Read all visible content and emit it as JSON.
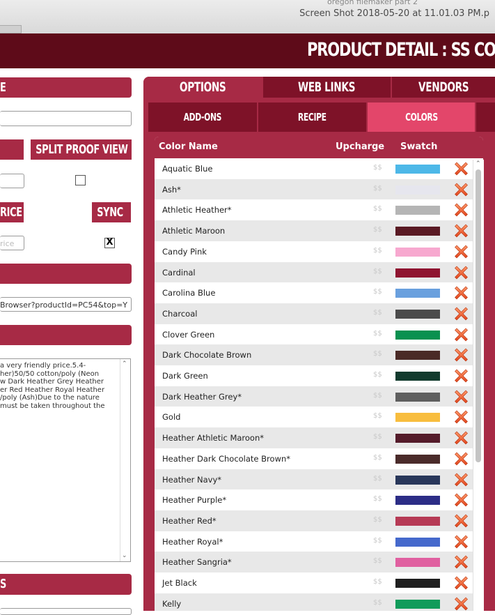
{
  "window": {
    "title": "Screen Shot 2018-05-20 at 11.01.03 PM.p",
    "faint_title": "oregon filemaker part 2"
  },
  "header": {
    "title": "PRODUCT DETAIL : SS COTT"
  },
  "left": {
    "section_e": "E",
    "split_proof_label": "SPLIT PROOF VIEW",
    "rice_label": "RICE",
    "sync_label": "SYNC",
    "price_placeholder": "rice",
    "sync_checked": "X",
    "url_value": "Browser?productId=PC54&top=Y",
    "description_lines": [
      "a very friendly price.5.4-",
      "her)50/50 cotton/poly (Neon",
      "w Dark Heather Grey Heather",
      "er Red Heather Royal Heather",
      "/poly (Ash)Due to the nature",
      "must be taken throughout the"
    ],
    "bottom_label": "S"
  },
  "tabs": [
    "OPTIONS",
    "WEB LINKS",
    "VENDORS"
  ],
  "subtabs": [
    "ADD-ONS",
    "RECIPE",
    "COLORS"
  ],
  "colors_table": {
    "headers": {
      "name": "Color Name",
      "upcharge": "Upcharge",
      "swatch": "Swatch"
    },
    "rows": [
      {
        "name": "Aquatic Blue",
        "price": "$$",
        "color": "#4db8e8"
      },
      {
        "name": "Ash*",
        "price": "$$",
        "color": "#e6e6ee"
      },
      {
        "name": "Athletic Heather*",
        "price": "$$",
        "color": "#b5b5b5"
      },
      {
        "name": "Athletic Maroon",
        "price": "$$",
        "color": "#5a1a24"
      },
      {
        "name": "Candy Pink",
        "price": "$$",
        "color": "#f7a8cf"
      },
      {
        "name": "Cardinal",
        "price": "$$",
        "color": "#8f1430"
      },
      {
        "name": "Carolina Blue",
        "price": "$$",
        "color": "#6aa0de"
      },
      {
        "name": "Charcoal",
        "price": "$$",
        "color": "#4b4b4b"
      },
      {
        "name": "Clover Green",
        "price": "$$",
        "color": "#0a9150"
      },
      {
        "name": "Dark Chocolate Brown",
        "price": "$$",
        "color": "#4a2a26"
      },
      {
        "name": "Dark Green",
        "price": "$$",
        "color": "#133b2e"
      },
      {
        "name": "Dark Heather Grey*",
        "price": "$$",
        "color": "#5f5f5f"
      },
      {
        "name": "Gold",
        "price": "$$",
        "color": "#f8bd3e"
      },
      {
        "name": "Heather Athletic Maroon*",
        "price": "$$",
        "color": "#551c2b"
      },
      {
        "name": "Heather Dark Chocolate Brown*",
        "price": "$$",
        "color": "#4a2b2a"
      },
      {
        "name": "Heather Navy*",
        "price": "$$",
        "color": "#29375a"
      },
      {
        "name": "Heather Purple*",
        "price": "$$",
        "color": "#2c2d86"
      },
      {
        "name": "Heather Red*",
        "price": "$$",
        "color": "#b63a55"
      },
      {
        "name": "Heather Royal*",
        "price": "$$",
        "color": "#4569cc"
      },
      {
        "name": "Heather Sangria*",
        "price": "$$",
        "color": "#e060a0"
      },
      {
        "name": "Jet Black",
        "price": "$$",
        "color": "#1f1f1f"
      },
      {
        "name": "Kelly",
        "price": "$$",
        "color": "#119b5a"
      }
    ]
  },
  "theme": {
    "maroon_dark": "#5e0b19",
    "maroon": "#a72a45",
    "tab_dark": "#7e1228",
    "tab_active": "#e3466a"
  }
}
